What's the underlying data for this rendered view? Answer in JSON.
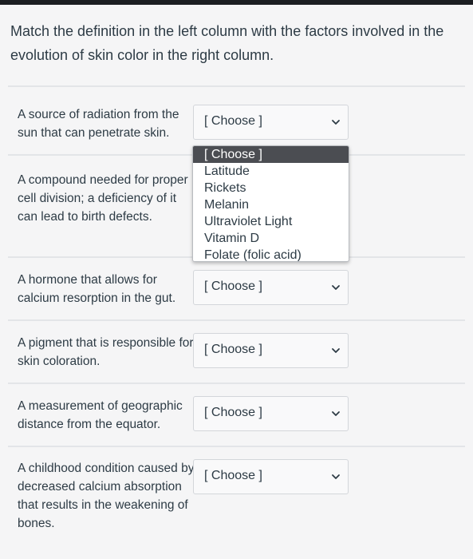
{
  "question": {
    "prompt": "Match the definition in the left column with the factors involved in the evolution of skin color in the right column."
  },
  "rows": [
    {
      "definition": "A source of radiation from the sun that can penetrate skin.",
      "selected": "[ Choose ]"
    },
    {
      "definition": "A compound needed for proper cell division; a deficiency of it can lead to birth defects.",
      "selected": ""
    },
    {
      "definition": "A hormone that allows for calcium resorption in the gut.",
      "selected": "[ Choose ]"
    },
    {
      "definition": "A pigment that is responsible for skin coloration.",
      "selected": "[ Choose ]"
    },
    {
      "definition": "A measurement of geographic distance from the equator.",
      "selected": "[ Choose ]"
    },
    {
      "definition": "A childhood condition caused by decreased calcium absorption that results in the weakening of bones.",
      "selected": "[ Choose ]"
    }
  ],
  "dropdown": {
    "options": [
      "[ Choose ]",
      "Latitude",
      "Rickets",
      "Melanin",
      "Ultraviolet Light",
      "Vitamin D",
      "Folate (folic acid)"
    ],
    "highlighted": "[ Choose ]"
  },
  "colors": {
    "page_bg": "#f5f5f6",
    "text": "#2d3b45",
    "highlight": "#4b4d52",
    "top_bar": "#1c1e22"
  }
}
